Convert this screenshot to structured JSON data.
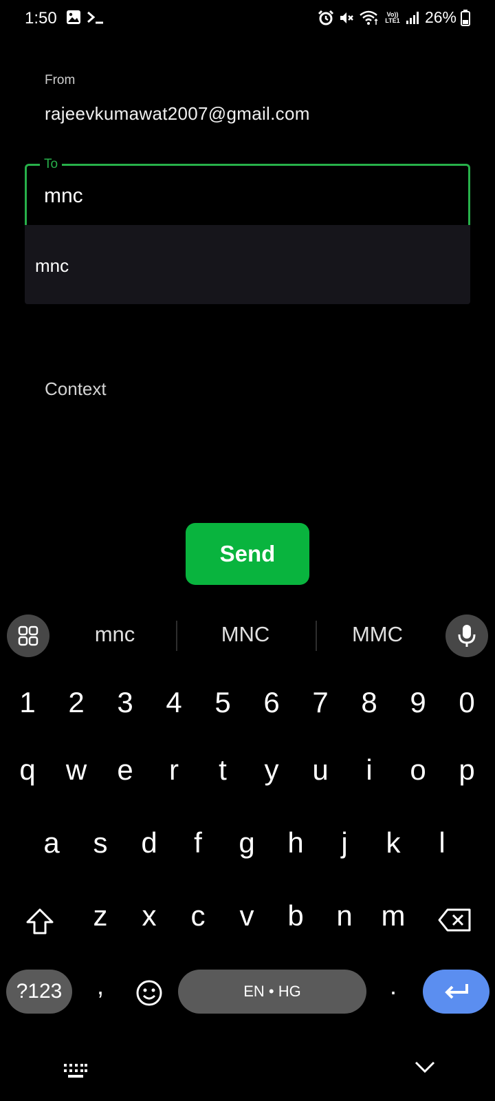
{
  "status_bar": {
    "time": "1:50",
    "battery": "26%",
    "network": "Vo)) LTE1",
    "icons": [
      "gallery-icon",
      "terminal-icon",
      "alarm-icon",
      "mute-icon",
      "wifi-icon",
      "signal-icon",
      "battery-icon"
    ]
  },
  "form": {
    "from_label": "From",
    "from_value": "rajeevkumawat2007@gmail.com",
    "to_label": "To",
    "to_value": "mnc",
    "to_suggestion": "mnc",
    "context_placeholder": "Context",
    "send_label": "Send",
    "accent_color": "#27b04a",
    "button_color": "#09b43e"
  },
  "keyboard": {
    "suggestions": [
      "mnc",
      "MNC",
      "MMC"
    ],
    "row_numbers": [
      "1",
      "2",
      "3",
      "4",
      "5",
      "6",
      "7",
      "8",
      "9",
      "0"
    ],
    "row_1": [
      "q",
      "w",
      "e",
      "r",
      "t",
      "y",
      "u",
      "i",
      "o",
      "p"
    ],
    "row_2": [
      "a",
      "s",
      "d",
      "f",
      "g",
      "h",
      "j",
      "k",
      "l"
    ],
    "row_3": [
      "z",
      "x",
      "c",
      "v",
      "b",
      "n",
      "m"
    ],
    "symbols_label": "?123",
    "comma": ",",
    "period": ".",
    "space_label": "EN • HG",
    "enter_color": "#5b8ef0"
  }
}
